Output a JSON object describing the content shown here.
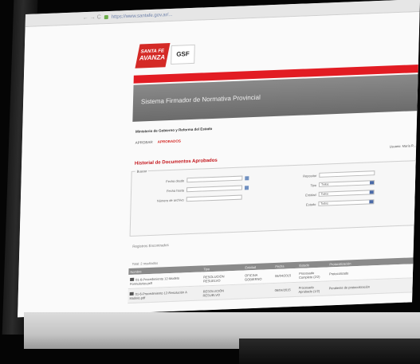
{
  "browser": {
    "nav_glyphs": "← → C",
    "url": "https://www.santafe.gov.ar/..."
  },
  "brand": {
    "logo_line1": "SANTA FE",
    "logo_line2": "AVANZA",
    "logo_gsf": "GSF",
    "accent": "#e21c23"
  },
  "header": {
    "system_title": "Sistema Firmador de Normativa Provincial"
  },
  "section": {
    "ministry": "Ministerio de Gobierno y Reforma del Estado",
    "tabs": [
      "APROBAR",
      "APROBADOS"
    ],
    "user": "Usuario: María R..."
  },
  "history": {
    "title": "Historial de Documentos Aprobados",
    "filter_legend": "Buscar",
    "left_fields": [
      {
        "label": "Fecha desde"
      },
      {
        "label": "Fecha hasta"
      },
      {
        "label": "Número de archivo"
      }
    ],
    "right_fields": [
      {
        "label": "Repositor",
        "value": ""
      },
      {
        "label": "Tipo",
        "value": "Todos"
      },
      {
        "label": "Entidad",
        "value": "Todos"
      },
      {
        "label": "Estado",
        "value": "Todos"
      }
    ]
  },
  "results": {
    "label": "Registros Encontrados",
    "total": "Total: 2 resultados"
  },
  "table": {
    "columns": [
      "Nombre",
      "Tipo",
      "Entidad",
      "Fecha",
      "Estado",
      "Protocolización"
    ],
    "rows": [
      {
        "nombre": "01-6-Procedimiento 12-Modelo Formularios.pdf",
        "tipo": "RESOLUCIÓN RESUELVO",
        "entidad": "OFICINA GOBIERNO",
        "fecha": "06/04/2015",
        "estado": "Procesado Completo (2/2)",
        "protocolizacion": "Protocolizado"
      },
      {
        "nombre": "01-6-Procedimiento 12-Resolución A Modelo.pdf",
        "tipo": "RESOLUCIÓN RESUELVO",
        "entidad": "",
        "fecha": "06/04/2015",
        "estado": "Procesado Aprobado (1/2)",
        "protocolizacion": "Pendiente de protocolización"
      }
    ]
  }
}
